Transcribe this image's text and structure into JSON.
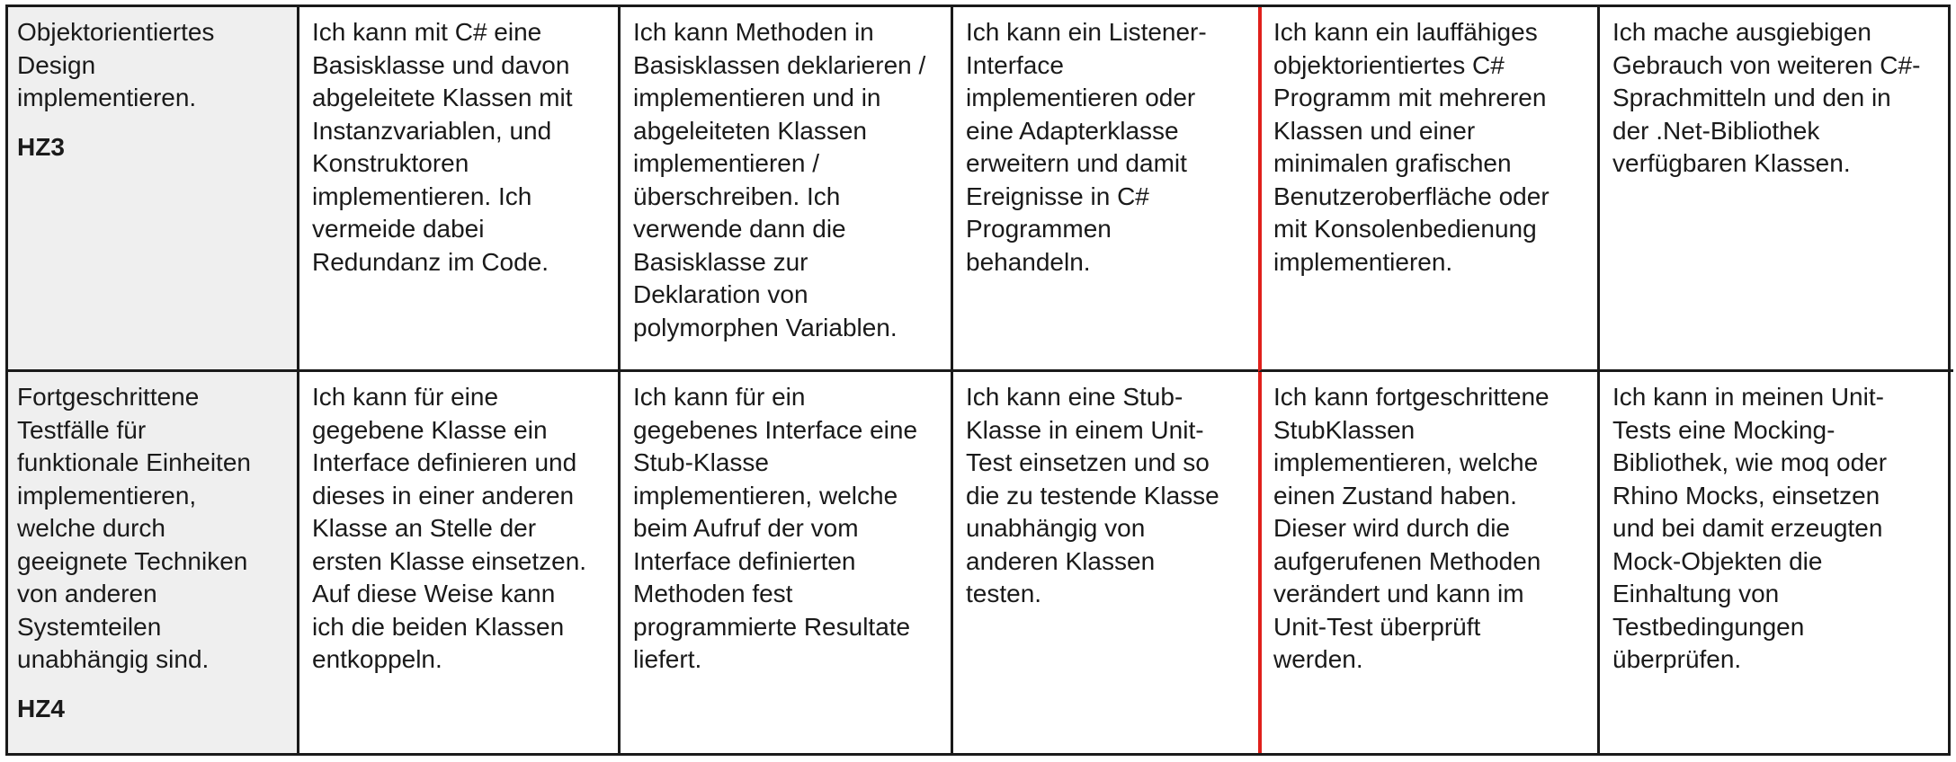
{
  "rows": [
    {
      "topic": "Objektorientiertes\nDesign\nimplementieren.",
      "code": "HZ3",
      "cells": [
        "Ich kann mit C# eine\nBasisklasse und davon\nabgeleitete Klassen mit\nInstanzvariablen, und\nKonstruktoren\nimplementieren. Ich\nvermeide dabei\nRedundanz im Code.",
        "Ich kann Methoden in\nBasisklassen deklarieren /\nimplementieren und in\nabgeleiteten Klassen\nimplementieren /\nüberschreiben. Ich\nverwende dann die\nBasisklasse zur\nDeklaration von\npolymorphen Variablen.",
        "Ich kann ein Listener-\nInterface\nimplementieren oder\neine Adapterklasse\nerweitern und damit\nEreignisse in C#\nProgrammen\nbehandeln.",
        "Ich kann ein lauffähiges\nobjektorientiertes C#\nProgramm mit mehreren\nKlassen und einer\nminimalen grafischen\nBenutzeroberfläche oder\nmit Konsolenbedienung\nimplementieren.",
        "Ich mache ausgiebigen\nGebrauch von weiteren C#-\nSprachmitteln und den in\nder .Net-Bibliothek\nverfügbaren Klassen."
      ]
    },
    {
      "topic": "Fortgeschrittene\nTestfälle für\nfunktionale Einheiten\nimplementieren,\nwelche durch\ngeeignete Techniken\nvon anderen\nSystemteilen\nunabhängig sind.",
      "code": "HZ4",
      "cells": [
        "Ich kann für eine\ngegebene Klasse ein\nInterface definieren und\ndieses in einer anderen\nKlasse an Stelle der\nersten Klasse einsetzen.\nAuf diese Weise kann\nich die beiden Klassen\nentkoppeln.",
        "Ich kann für ein\ngegebenes Interface eine\nStub-Klasse\nimplementieren, welche\nbeim Aufruf der vom\nInterface definierten\nMethoden  fest\nprogrammierte Resultate\nliefert.",
        "Ich kann eine Stub-\nKlasse in einem Unit-\nTest einsetzen und so\ndie zu testende Klasse\nunabhängig von\nanderen Klassen\ntesten.",
        "Ich kann fortgeschrittene\nStubKlassen\nimplementieren, welche\neinen Zustand haben.\nDieser wird durch die\naufgerufenen Methoden\nverändert und kann im\nUnit-Test überprüft\nwerden.",
        "Ich kann in meinen Unit-\nTests eine Mocking-\nBibliothek, wie moq  oder\nRhino Mocks, einsetzen\nund bei damit erzeugten\nMock-Objekten die\nEinhaltung von\nTestbedingungen\nüberprüfen."
      ]
    }
  ],
  "colors": {
    "topic_background": "#efefef",
    "border": "#1a1a1a",
    "highlight_border": "#e0201b"
  }
}
